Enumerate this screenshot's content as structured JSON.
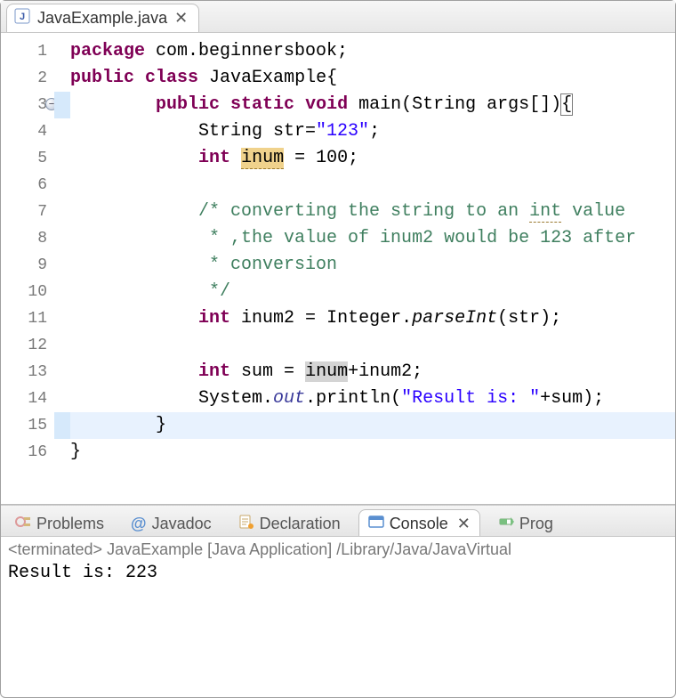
{
  "editor": {
    "tab": {
      "label": "JavaExample.java"
    },
    "gutter_numbers": [
      "1",
      "2",
      "3",
      "4",
      "5",
      "6",
      "7",
      "8",
      "9",
      "10",
      "11",
      "12",
      "13",
      "14",
      "15",
      "16"
    ],
    "fold_at_line_index": 2,
    "margin_highlight_lines": [
      2,
      14
    ],
    "current_line_index": 14,
    "code": {
      "package_kw": "package",
      "package_name": " com.beginnersbook;",
      "public_kw": "public",
      "class_kw": "class",
      "class_name": " JavaExample{",
      "static_kw": "static",
      "void_kw": "void",
      "main_sig_1": " main(String args[])",
      "brace_open": "{",
      "l4_pre": "            String str=",
      "l4_str": "\"123\"",
      "l4_post": ";",
      "int_kw": "int",
      "l5_pre": " ",
      "l5_var": "inum",
      "l5_post": " = 100;",
      "l7": "            /* converting the string to an ",
      "l7_int": "int",
      "l7_post": " value",
      "l8": "             * ,the value of inum2 would be 123 after",
      "l9": "             * conversion",
      "l10": "             */",
      "l11_pre": "            ",
      "l11_mid": " inum2 = Integer.",
      "l11_parseInt": "parseInt",
      "l11_post": "(str);",
      "l13_pre": "            ",
      "l13_mid": " sum = ",
      "l13_var": "inum",
      "l13_post": "+inum2;",
      "l14_pre": "            System.",
      "l14_out": "out",
      "l14_mid": ".println(",
      "l14_str": "\"Result is: \"",
      "l14_post": "+sum);",
      "l15": "        }",
      "l16": "}"
    }
  },
  "views": {
    "problems": "Problems",
    "javadoc": "Javadoc",
    "declaration": "Declaration",
    "console": "Console",
    "progress": "Prog"
  },
  "console": {
    "status": "<terminated> JavaExample [Java Application] /Library/Java/JavaVirtual",
    "output": "Result is: 223"
  }
}
